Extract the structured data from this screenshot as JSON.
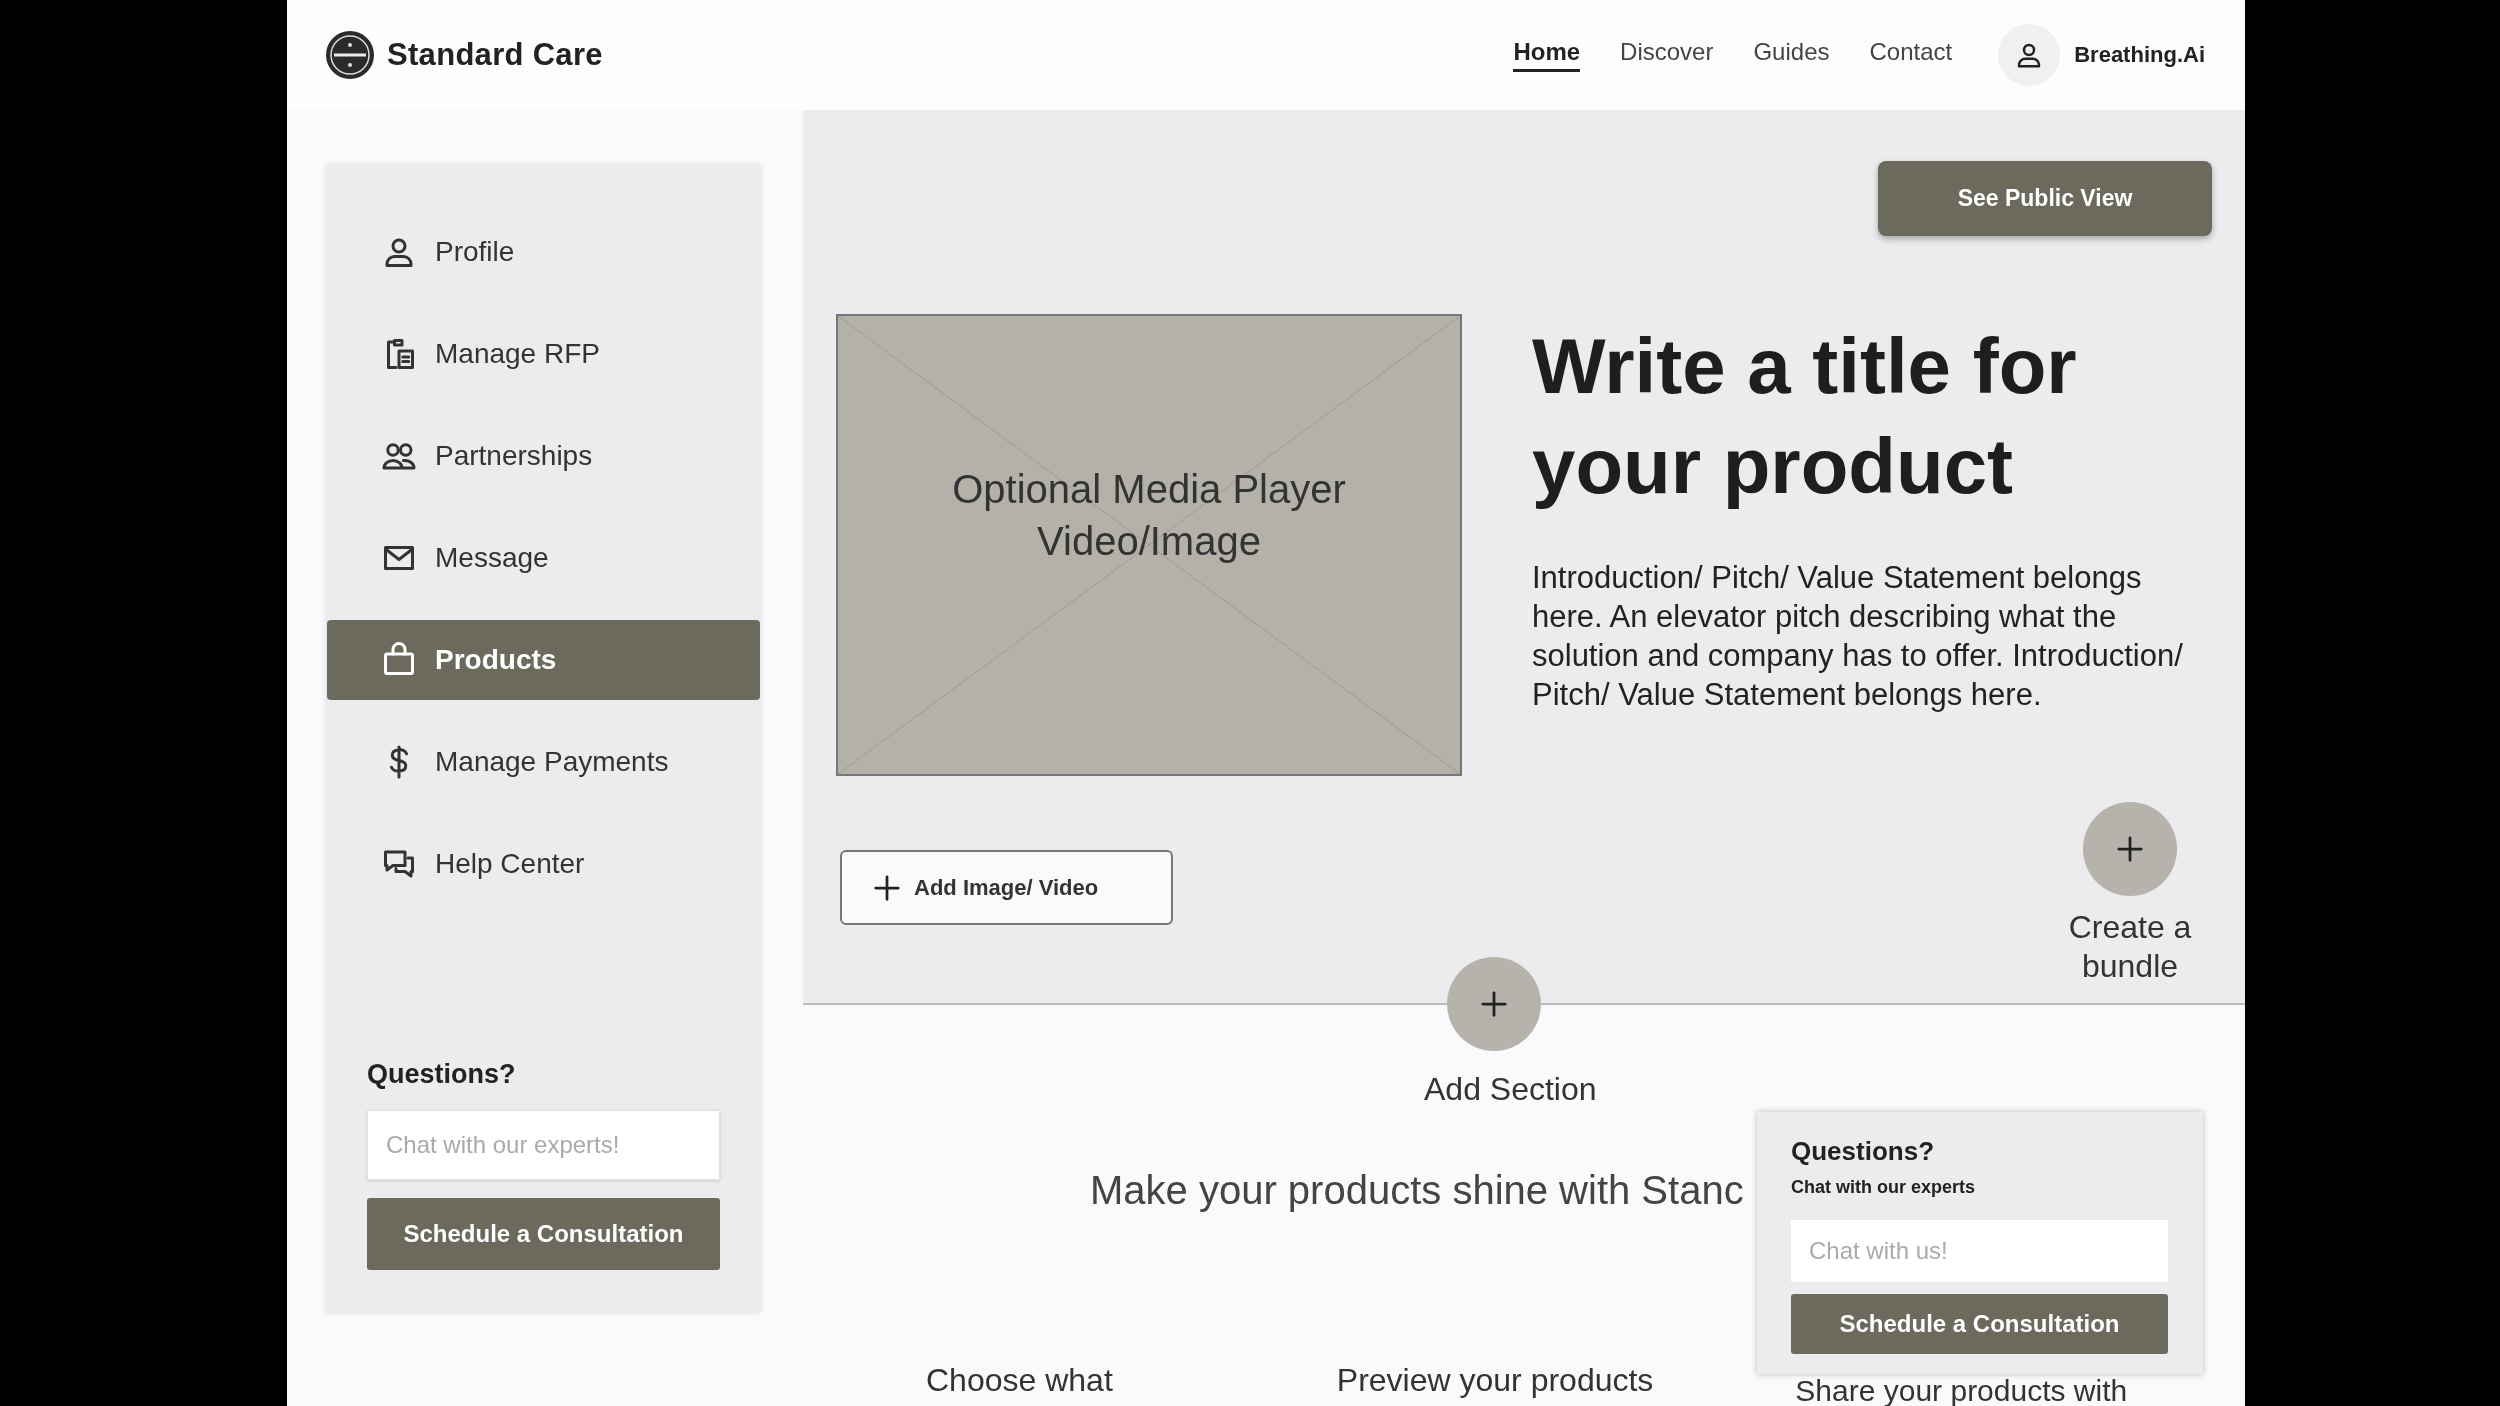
{
  "header": {
    "brand": "Standard Care",
    "nav": [
      {
        "label": "Home",
        "selected": true
      },
      {
        "label": "Discover",
        "selected": false
      },
      {
        "label": "Guides",
        "selected": false
      },
      {
        "label": "Contact",
        "selected": false
      }
    ],
    "account": "Breathing.Ai"
  },
  "sidebar": {
    "items": [
      {
        "label": "Profile",
        "selected": false
      },
      {
        "label": "Manage RFP",
        "selected": false
      },
      {
        "label": "Partnerships",
        "selected": false
      },
      {
        "label": "Message",
        "selected": false
      },
      {
        "label": "Products",
        "selected": true
      },
      {
        "label": "Manage Payments",
        "selected": false
      },
      {
        "label": "Help Center",
        "selected": false
      }
    ],
    "questions": {
      "title": "Questions?",
      "placeholder": "Chat with our experts!",
      "button": "Schedule a Consultation"
    }
  },
  "product": {
    "public_view_button": "See Public View",
    "media_label": "Optional Media Player Video/Image",
    "title": "Write a title for your product",
    "pitch": "Introduction/ Pitch/ Value Statement belongs here. An elevator pitch describing what the solution and company has to offer. Introduction/ Pitch/ Value Statement belongs here.",
    "add_media_button": "Add Image/ Video",
    "bundle_button": "Create a bundle"
  },
  "add_section": "Add Section",
  "tagline": "Make your products shine with Stanc",
  "steps": [
    "Choose what",
    "Preview your products",
    "Share your products with"
  ],
  "chat_popup": {
    "title": "Questions?",
    "subtitle": "Chat with our experts",
    "placeholder": "Chat with us!",
    "button": "Schedule a Consultation"
  }
}
